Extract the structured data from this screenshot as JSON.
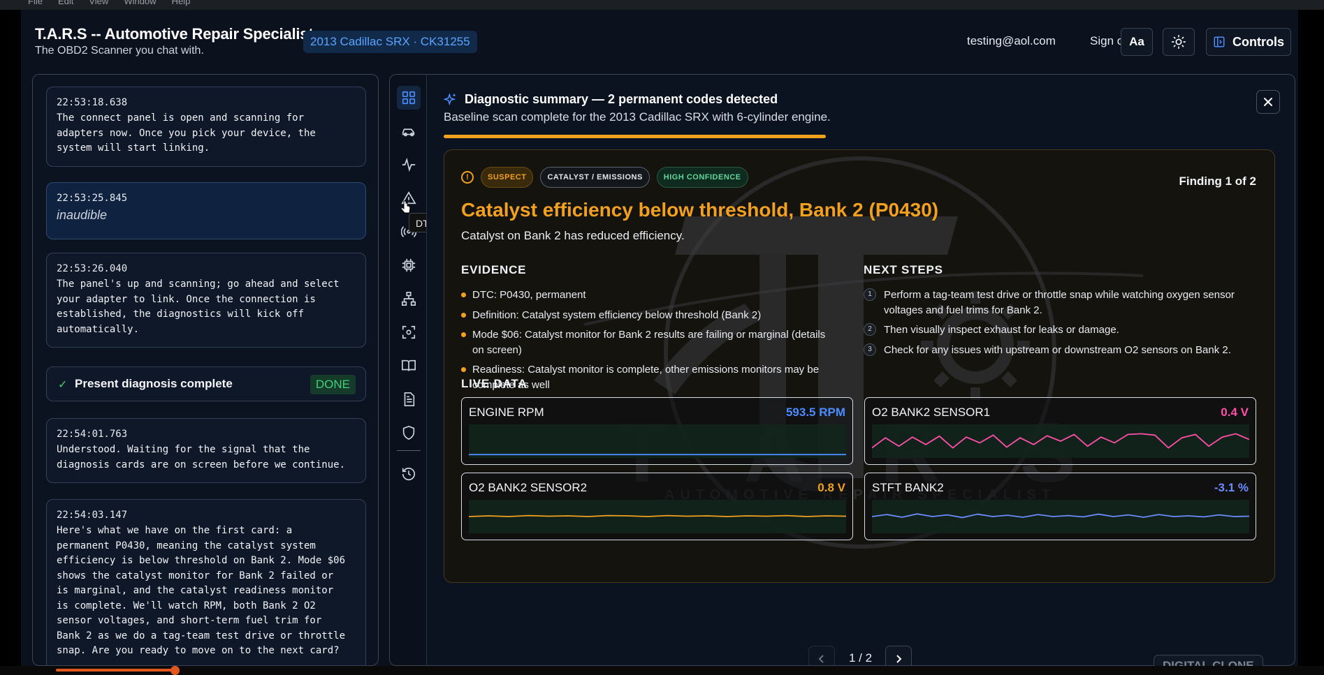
{
  "os_menu": [
    "File",
    "Edit",
    "View",
    "Window",
    "Help"
  ],
  "header": {
    "title": "T.A.R.S -- Automotive Repair Specialist",
    "subtitle": "The OBD2 Scanner you chat with.",
    "vehicle": "2013 Cadillac SRX · CK31255",
    "email": "testing@aol.com",
    "signout": "Sign out",
    "font_btn": "Aa",
    "controls": "Controls"
  },
  "transcript": [
    {
      "ts": "22:53:18.638",
      "text": "The connect panel is open and scanning for\nadapters now. Once you pick your device, the\nsystem will start linking."
    },
    {
      "ts": "22:53:25.845",
      "text": "inaudible",
      "user": true
    },
    {
      "ts": "22:53:26.040",
      "text": "The panel's up and scanning; go ahead and select\nyour adapter to link. Once the connection is\nestablished, the diagnostics will kick off\nautomatically."
    },
    {
      "ts": "22:54:01.763",
      "text": "Understood. Waiting for the signal that the\ndiagnosis cards are on screen before we continue."
    },
    {
      "ts": "22:54:03.147",
      "text": "Here's what we have on the first card: a\npermanent P0430, meaning the catalyst system\nefficiency is below threshold on Bank 2. Mode $06\nshows the catalyst monitor for Bank 2 failed or\nis marginal, and the catalyst readiness monitor\nis complete. We'll watch RPM, both Bank 2 O2\nsensor voltages, and short-term fuel trim for\nBank 2 as we do a tag-team test drive or throttle\nsnap. Are you ready to move on to the next card?"
    }
  ],
  "status": {
    "label": "Present diagnosis complete",
    "badge": "DONE"
  },
  "tooltip": "DTC codes",
  "rail_icons": [
    "dashboard-icon",
    "car-icon",
    "pulse-icon",
    "warning-triangle-icon",
    "broadcast-icon",
    "chip-icon",
    "network-icon",
    "scan-icon",
    "book-icon",
    "document-icon",
    "shield-icon",
    "history-icon"
  ],
  "diagnostic": {
    "title": "Diagnostic summary — 2 permanent codes detected",
    "subtitle": "Baseline scan complete for the 2013 Cadillac SRX with 6-cylinder engine.",
    "progress": 0.46
  },
  "finding": {
    "tags": [
      "SUSPECT",
      "CATALYST / EMISSIONS",
      "HIGH CONFIDENCE"
    ],
    "count": "Finding 1 of 2",
    "title": "Catalyst efficiency below threshold, Bank 2 (P0430)",
    "subtitle": "Catalyst on Bank 2 has reduced efficiency.",
    "evidence_heading": "EVIDENCE",
    "evidence": [
      "DTC: P0430, permanent",
      "Definition: Catalyst system efficiency below threshold (Bank 2)",
      "Mode $06: Catalyst monitor for Bank 2 results are failing or marginal (details on screen)",
      "Readiness: Catalyst monitor is complete, other emissions monitors may be complete as well"
    ],
    "next_heading": "NEXT STEPS",
    "next_steps": [
      "Perform a tag-team test drive or throttle snap while watching oxygen sensor voltages and fuel trims for Bank 2.",
      "Then visually inspect exhaust for leaks or damage.",
      "Check for any issues with upstream or downstream O2 sensors on Bank 2."
    ],
    "live_heading": "LIVE DATA",
    "live": [
      {
        "name": "ENGINE RPM",
        "value": "593.5 RPM",
        "color": "#4b8dff",
        "trace": [
          0.1,
          0.1,
          0.1,
          0.1,
          0.1,
          0.1,
          0.1,
          0.1,
          0.1,
          0.1,
          0.1,
          0.1,
          0.1,
          0.1,
          0.1,
          0.1,
          0.1,
          0.1,
          0.1,
          0.1
        ]
      },
      {
        "name": "O2 BANK2 SENSOR1",
        "value": "0.4 V",
        "color": "#ff4fa8",
        "trace": [
          0.3,
          0.6,
          0.35,
          0.62,
          0.4,
          0.65,
          0.3,
          0.62,
          0.45,
          0.68,
          0.32,
          0.6,
          0.4,
          0.66,
          0.5,
          0.7,
          0.35,
          0.62,
          0.45,
          0.7,
          0.72,
          0.68,
          0.3,
          0.6,
          0.7,
          0.35,
          0.62,
          0.72,
          0.55
        ]
      },
      {
        "name": "O2 BANK2 SENSOR2",
        "value": "0.8 V",
        "color": "#f2a11e",
        "trace": [
          0.5,
          0.52,
          0.5,
          0.53,
          0.51,
          0.52,
          0.5,
          0.53,
          0.52,
          0.5,
          0.53,
          0.51,
          0.52,
          0.5,
          0.52,
          0.51,
          0.53,
          0.5,
          0.52,
          0.51
        ]
      },
      {
        "name": "STFT BANK2",
        "value": "-3.1 %",
        "color": "#6b8cff",
        "trace": [
          0.5,
          0.56,
          0.48,
          0.58,
          0.5,
          0.55,
          0.47,
          0.57,
          0.5,
          0.54,
          0.48,
          0.56,
          0.5,
          0.53,
          0.49,
          0.57,
          0.5,
          0.55,
          0.48,
          0.56,
          0.5,
          0.52,
          0.49,
          0.55,
          0.5,
          0.51
        ]
      }
    ]
  },
  "watermark": {
    "letters": "T A R S",
    "tagline": "AUTOMOTIVE REPAIR SPECIALIST"
  },
  "pager": {
    "label": "1 / 2"
  },
  "clone_badge": "DIGITAL CLONE"
}
